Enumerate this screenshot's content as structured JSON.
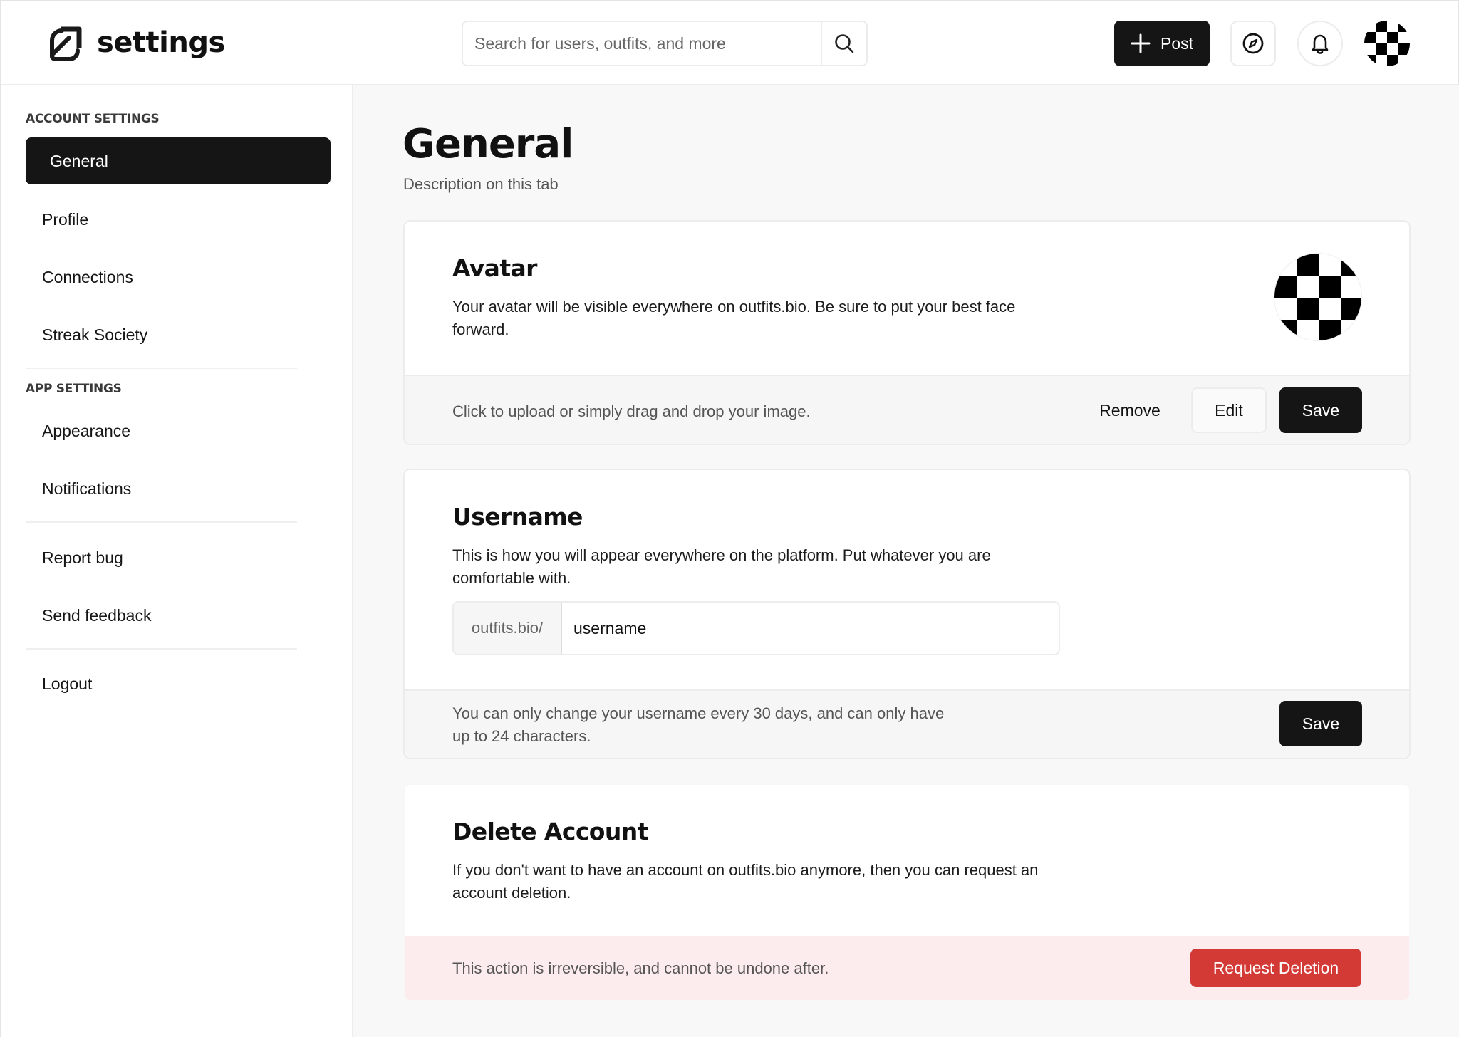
{
  "header": {
    "brand": "settings",
    "search_placeholder": "Search for users, outfits, and more",
    "post_label": "Post"
  },
  "sidebar": {
    "account_title": "ACCOUNT SETTINGS",
    "account_items": [
      {
        "label": "General",
        "active": true
      },
      {
        "label": "Profile"
      },
      {
        "label": "Connections"
      },
      {
        "label": "Streak Society"
      }
    ],
    "app_title": "APP SETTINGS",
    "app_items": [
      {
        "label": "Appearance"
      },
      {
        "label": "Notifications"
      }
    ],
    "support_items": [
      {
        "label": "Report bug"
      },
      {
        "label": "Send feedback"
      }
    ],
    "logout_label": "Logout"
  },
  "main": {
    "title": "General",
    "description": "Description on this tab",
    "avatar_card": {
      "title": "Avatar",
      "text": "Your avatar will be visible everywhere on outfits.bio. Be sure to put your best face forward.",
      "footer_text": "Click to upload or simply drag and drop your image.",
      "remove_label": "Remove",
      "edit_label": "Edit",
      "save_label": "Save"
    },
    "username_card": {
      "title": "Username",
      "text": "This is how you will appear everywhere on the platform. Put whatever you are comfortable with.",
      "prefix": "outfits.bio/",
      "value": "username",
      "footer_text": "You can only change your username every 30 days, and can only have up to 24 characters.",
      "save_label": "Save"
    },
    "delete_card": {
      "title": "Delete Account",
      "text": "If you don't want to have an account on outfits.bio anymore, then you can request an account deletion.",
      "footer_text": "This action is irreversible, and cannot be undone after.",
      "button_label": "Request Deletion"
    }
  },
  "colors": {
    "primary": "#151515",
    "danger": "#d33a36",
    "danger_bg": "#fdeced",
    "page_bg": "#f8f8f8"
  },
  "icons": [
    "logo-icon",
    "search-icon",
    "plus-icon",
    "compass-icon",
    "bell-icon"
  ]
}
